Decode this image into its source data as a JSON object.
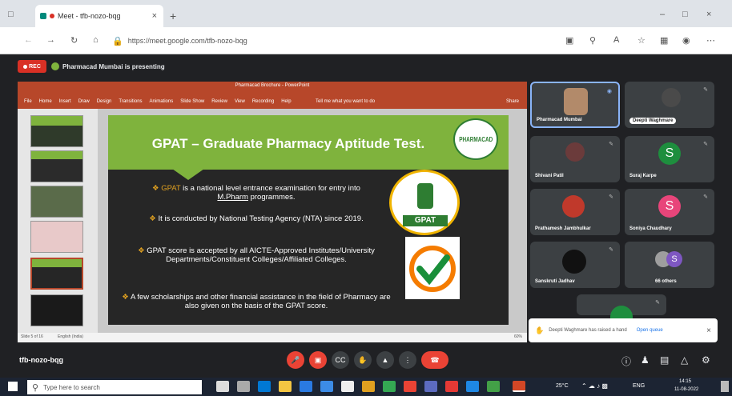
{
  "browser": {
    "tab_title": "Meet - tfb-nozo-bqg",
    "url": "https://meet.google.com/tfb-nozo-bqg"
  },
  "meet": {
    "rec_label": "REC",
    "presenting_text": "Pharmacad Mumbai is presenting",
    "meeting_code": "tfb-nozo-bqg"
  },
  "ppt": {
    "window_title": "Pharmacad Brochure - PowerPoint",
    "menu": [
      "File",
      "Home",
      "Insert",
      "Draw",
      "Design",
      "Transitions",
      "Animations",
      "Slide Show",
      "Review",
      "View",
      "Recording",
      "Help"
    ],
    "tell_me": "Tell me what you want to do",
    "share": "Share",
    "status_left": "Slide 5 of 16",
    "status_lang": "English (India)",
    "zoom": "60%"
  },
  "slide": {
    "title": "GPAT – Graduate Pharmacy Aptitude Test.",
    "bullet1_a": "GPAT",
    "bullet1_b": " is a national level entrance examination for entry into",
    "bullet1_c": "M.Pharm",
    "bullet1_d": " programmes.",
    "bullet2": "It is conducted by National Testing Agency (NTA) since 2019.",
    "bullet3": "GPAT score is accepted by all AICTE-Approved Institutes/University Departments/Constituent Colleges/Affiliated Colleges.",
    "bullet4": "A few scholarships and other financial assistance in the field of Pharmacy are also given on the basis of the GPAT score.",
    "logo_text": "PHARMACAD",
    "seal_text": "GPAT",
    "seal_ring": "ALL INDIA COUNCIL FOR TECHNICAL EDUCATION"
  },
  "participants": [
    {
      "name": "Pharmacad Mumbai",
      "initial": "",
      "color": "#b28a6a"
    },
    {
      "name": "Deepti Waghmare",
      "initial": "",
      "color": "#4a4a4a"
    },
    {
      "name": "Shivani Patil",
      "initial": "",
      "color": "#6b3b3b"
    },
    {
      "name": "Suraj Karpe",
      "initial": "S",
      "color": "#1e8e3e"
    },
    {
      "name": "Prathamesh Jambhulkar",
      "initial": "",
      "color": "#c0392b"
    },
    {
      "name": "Soniya Chaudhary",
      "initial": "S",
      "color": "#e8457a"
    },
    {
      "name": "Sanskruti Jadhav",
      "initial": "",
      "color": "#111111"
    },
    {
      "name": "66 others",
      "initial": "S",
      "color": "#7e57c2"
    }
  ],
  "notification": {
    "text": "Deepti Waghmare has raised a hand",
    "action": "Open queue"
  },
  "taskbar": {
    "search_placeholder": "Type here to search",
    "weather": "25°C",
    "lang": "ENG",
    "time": "14:15",
    "date": "11-08-2022"
  },
  "colors": {
    "accent_green": "#7fb33d",
    "end_call_red": "#ea4335",
    "ppt_orange": "#b7472a"
  }
}
